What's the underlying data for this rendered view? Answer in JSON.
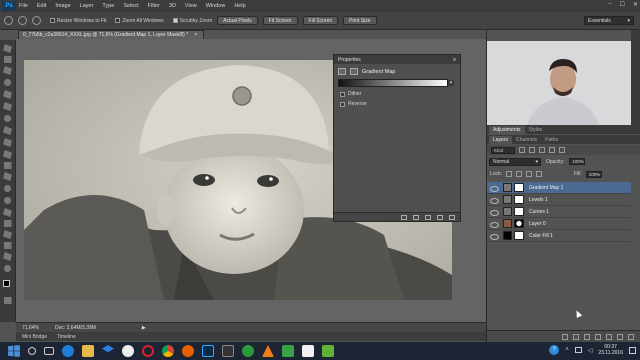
{
  "app": {
    "logo": "Ps",
    "menus": [
      "File",
      "Edit",
      "Image",
      "Layer",
      "Type",
      "Select",
      "Filter",
      "3D",
      "View",
      "Window",
      "Help"
    ],
    "window_controls": [
      "–",
      "☐",
      "✕"
    ]
  },
  "options_bar": {
    "resize_windows_label": "Resize Windows to Fit",
    "zoom_all_windows_label": "Zoom All Windows",
    "scrubby_zoom_label": "Scrubby Zoom",
    "actual_pixels": "Actual Pixels",
    "fit_screen": "Fit Screen",
    "fill_screen": "Fill Screen",
    "print_size": "Print Size",
    "workspace": "Essentials"
  },
  "document": {
    "tab_title": "0_77b5b_c2a36614_XXXL.jpg @ 71,6% (Gradient Map 1, Layer Mask/8) *",
    "close": "×"
  },
  "status_bar": {
    "zoom": "71,64%",
    "doc_size": "Doc: 2,64M/3,39M",
    "arrow": "▶"
  },
  "bottom_tabs": [
    "Mini Bridge",
    "Timeline"
  ],
  "properties_panel": {
    "header": "Properties",
    "title": "Gradient Map",
    "dither_label": "Dither",
    "reverse_label": "Reverse",
    "dropdown_arrow": "▾"
  },
  "adjustments_panel": {
    "tabs": [
      "Adjustments",
      "Styles"
    ]
  },
  "layers_panel": {
    "tabs": [
      "Layers",
      "Channels",
      "Paths"
    ],
    "kind_label": "Kind",
    "blend_mode": "Normal",
    "opacity_label": "Opacity:",
    "opacity_value": "100%",
    "lock_label": "Lock:",
    "fill_label": "Fill:",
    "fill_value": "100%",
    "layers": [
      {
        "name": "Gradient Map 1",
        "selected": true,
        "thumb": "#777777"
      },
      {
        "name": "Levels 1",
        "selected": false,
        "thumb": "#777777"
      },
      {
        "name": "Curves 1",
        "selected": false,
        "thumb": "#777777"
      },
      {
        "name": "Layer 0",
        "selected": false,
        "thumb": "#8a5a44"
      },
      {
        "name": "Color Fill 1",
        "selected": false,
        "thumb": "#000000"
      }
    ]
  },
  "taskbar": {
    "time": "00:37",
    "date": "23.11.2016",
    "help": "?"
  },
  "colors": {
    "accent_selected": "#4b6a92",
    "ps_blue": "#31a8ff"
  }
}
